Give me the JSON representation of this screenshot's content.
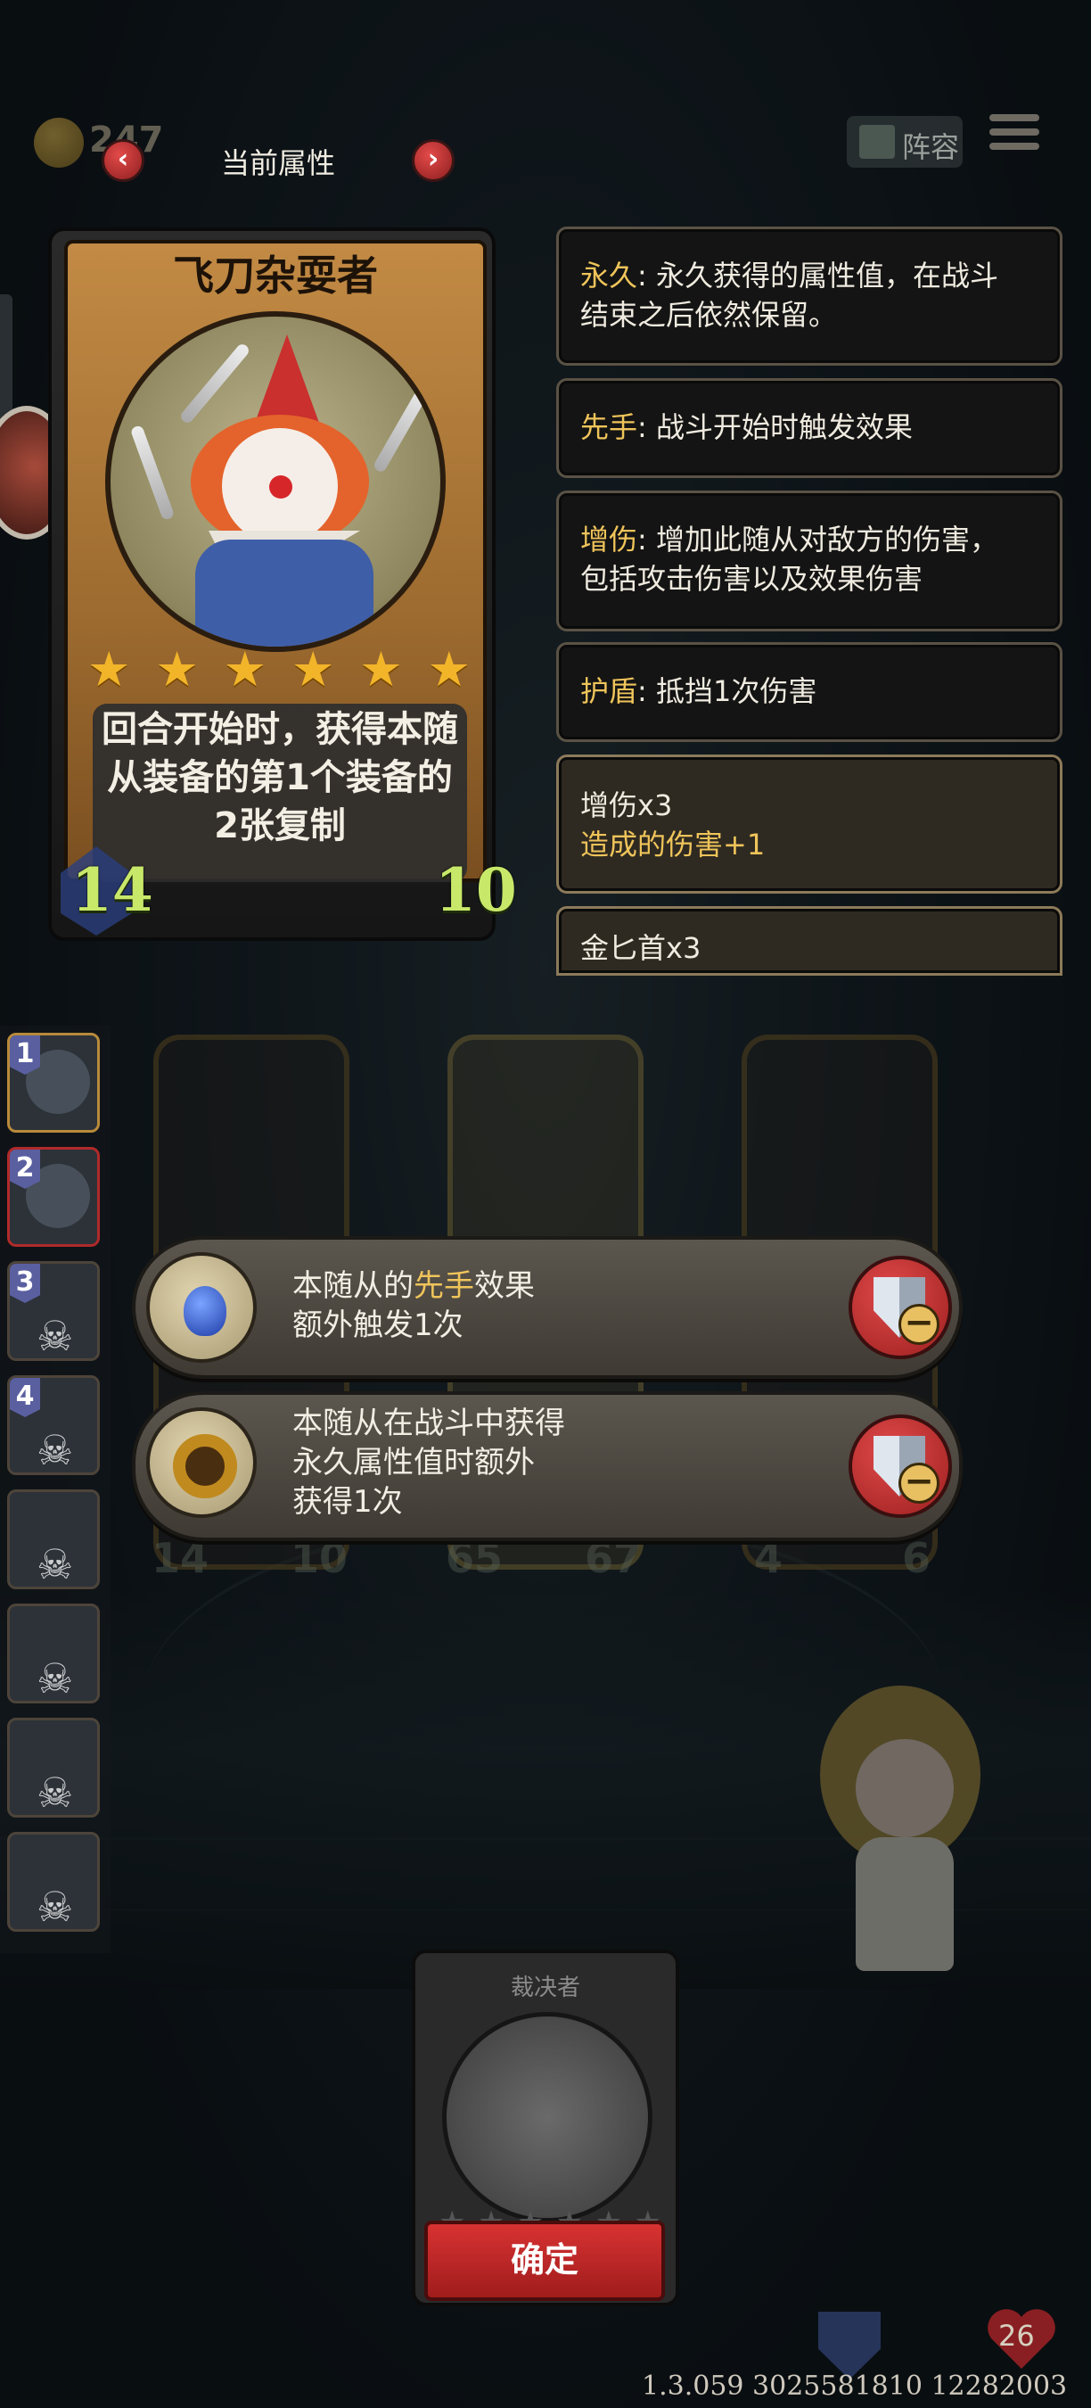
{
  "topbar": {
    "coin_count": "247",
    "title": "当前属性",
    "prev_arrow": "‹",
    "next_arrow": "›",
    "lineup_label": "阵容"
  },
  "card": {
    "name": "飞刀杂耍者",
    "stars": 6,
    "description_lines": [
      "回合开始时，获得本随",
      "从装备的第1个装备的",
      "2张复制"
    ],
    "attack": "14",
    "health": "10"
  },
  "keywords": [
    {
      "key": "永久",
      "text_lines": [
        ": 永久获得的属性值，在战斗",
        "结束之后依然保留。"
      ]
    },
    {
      "key": "先手",
      "text_lines": [
        ": 战斗开始时触发效果"
      ]
    },
    {
      "key": "增伤",
      "text_lines": [
        ": 增加此随从对敌方的伤害，",
        "包括攻击伤害以及效果伤害"
      ]
    },
    {
      "key": "护盾",
      "text_lines": [
        ": 抵挡1次伤害"
      ]
    }
  ],
  "equipment": [
    {
      "name": "增伤x3",
      "sub": "造成的伤害+1"
    },
    {
      "name": "金匕首x3"
    }
  ],
  "side_list": [
    "1",
    "2",
    "3",
    "4"
  ],
  "board_stats": {
    "left_atk": "14",
    "left_hp": "10",
    "mid_atk": "65",
    "mid_hp": "67",
    "right_atk": "4",
    "right_hp": "6"
  },
  "buffs": [
    {
      "line1_pre": "本随从的",
      "line1_key": "先手",
      "line1_post": "效果",
      "line2": "额外触发1次",
      "line3": ""
    },
    {
      "line1_pre": "本随从在战斗中获得",
      "line1_key": "",
      "line1_post": "",
      "line2": "永久属性值时额外",
      "line3": "获得1次"
    }
  ],
  "pick": {
    "name": "裁决者",
    "confirm_label": "确定"
  },
  "bottom": {
    "hp": "26",
    "version": "1.3.059 3025581810 12282003"
  },
  "colors": {
    "accent_gold": "#efc45a",
    "stat_green": "#c8e86a",
    "confirm_red": "#d83232"
  }
}
